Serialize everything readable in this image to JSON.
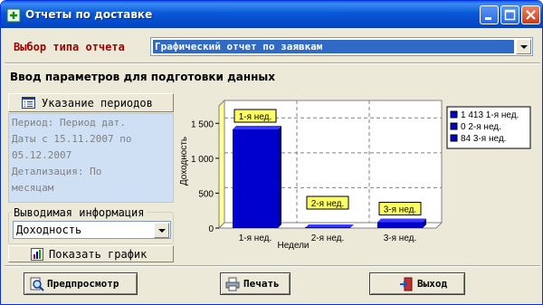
{
  "window": {
    "title": "Отчеты по доставке"
  },
  "report_type": {
    "label": "Выбор типа отчета",
    "selected": "Графический отчет по заявкам"
  },
  "section_title": "Ввод параметров для подготовки данных",
  "periods": {
    "button_label": "Указание периодов",
    "text": "Период: Период дат.\nДаты с 15.11.2007 по\n05.12.2007\nДетализация: По\nмесяцам"
  },
  "output": {
    "legend": "Выводимая информация",
    "selected": "Доходность"
  },
  "show_chart_label": "Показать график",
  "buttons": {
    "preview": "Предпросмотр",
    "print": "Печать",
    "exit": "Выход"
  },
  "colors": {
    "bar": "#0000cc",
    "label_bg": "#ffff66",
    "title_bar": "#0a58d8"
  },
  "chart_data": {
    "type": "bar",
    "categories": [
      "1-я нед.",
      "2-я нед.",
      "3-я нед."
    ],
    "values": [
      1413,
      0,
      84
    ],
    "data_labels": [
      "1-я нед.",
      "2-я нед.",
      "3-я нед."
    ],
    "legend": [
      "1 413 1-я нед.",
      "0 2-я нед.",
      "84 3-я нед."
    ],
    "xlabel": "Недели",
    "ylabel": "Доходность",
    "yticks": [
      "0",
      "500",
      "1 000",
      "1 500"
    ],
    "ylim": [
      0,
      1750
    ],
    "grid": true,
    "legend_position": "right"
  }
}
